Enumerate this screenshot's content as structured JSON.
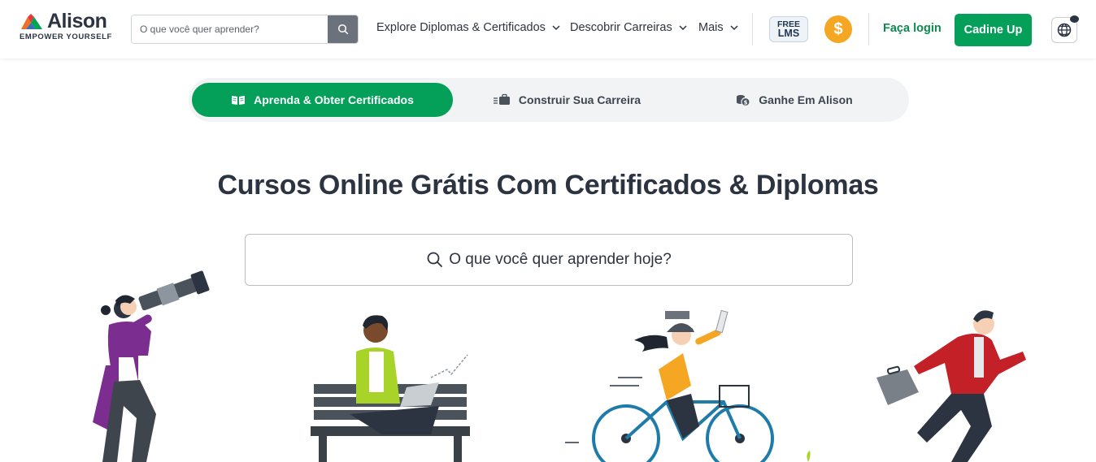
{
  "brand": {
    "name": "Alison",
    "tagline": "EMPOWER YOURSELF"
  },
  "header": {
    "search_placeholder": "O que você quer aprender?",
    "nav": [
      {
        "label": "Explore Diplomas & Certificados"
      },
      {
        "label": "Descobrir Carreiras"
      },
      {
        "label": "Mais"
      }
    ],
    "free_lms_top": "FREE",
    "free_lms_bottom": "LMS",
    "dollar_symbol": "$",
    "login_label": "Faça login",
    "signup_label": "Cadine Up"
  },
  "tabs": [
    {
      "label": "Aprenda & Obter Certificados",
      "active": true,
      "icon": "open-book-icon"
    },
    {
      "label": "Construir Sua Carreira",
      "active": false,
      "icon": "briefcase-icon"
    },
    {
      "label": "Ganhe Em Alison",
      "active": false,
      "icon": "coins-icon"
    }
  ],
  "hero": {
    "title": "Cursos Online Grátis Com Certificados & Diplomas",
    "search_placeholder": "O que você quer aprender hoje?"
  },
  "colors": {
    "brand_green": "#04a05a",
    "login_green": "#0b8a4e",
    "coin_orange": "#f5a623",
    "text_dark": "#2b3440"
  }
}
